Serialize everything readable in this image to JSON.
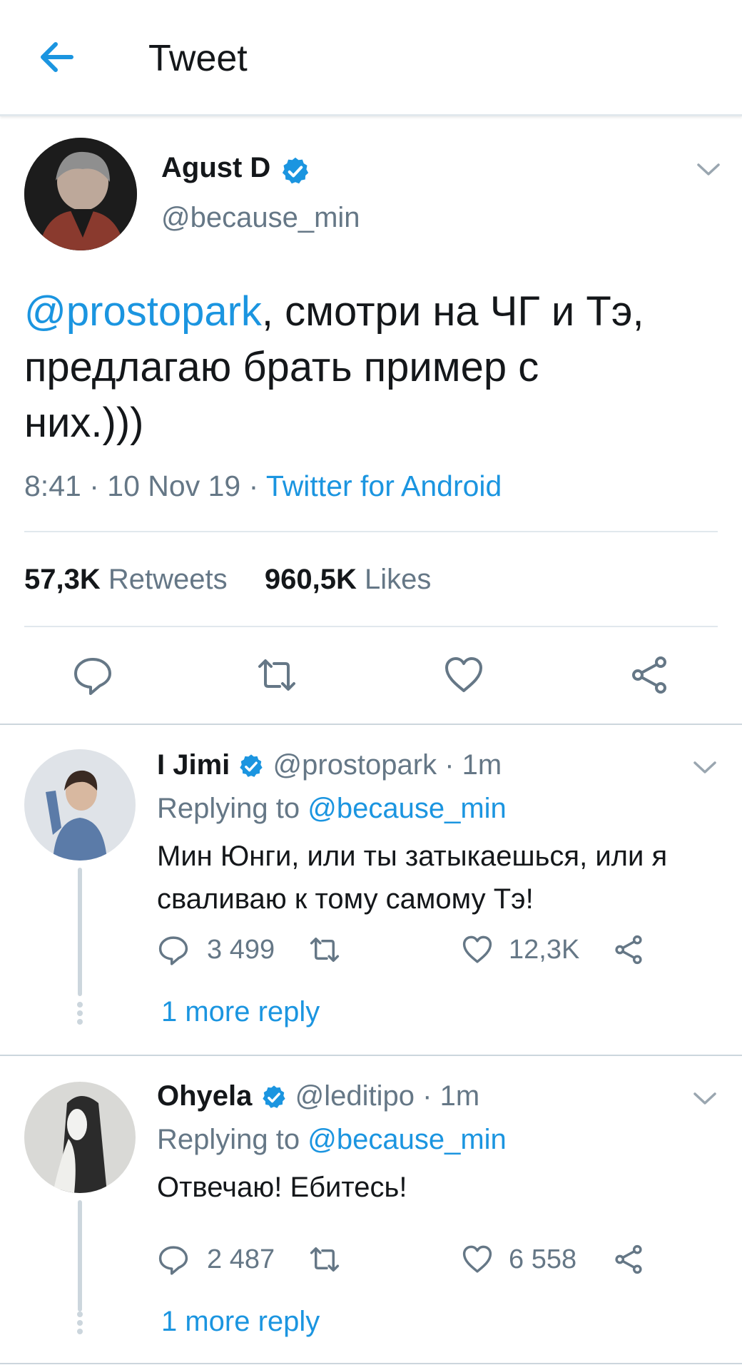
{
  "header": {
    "title": "Tweet"
  },
  "tweet": {
    "display_name": "Agust D",
    "handle": "@because_min",
    "mention": "@prostopark",
    "text_rest_1": ", смотри на ЧГ и Тэ,",
    "text_line_2": "предлагаю брать пример с",
    "text_line_3": "них.)))",
    "time": "8:41",
    "sep1": "·",
    "date": "10 Nov 19",
    "sep2": "·",
    "source": "Twitter for Android",
    "retweets_count": "57,3K",
    "retweets_label": "Retweets",
    "likes_count": "960,5K",
    "likes_label": "Likes"
  },
  "replies": [
    {
      "display_name": "I Jimi",
      "handle": "@prostopark",
      "age": "· 1m",
      "replying_prefix": "Replying to",
      "replying_to": "@because_min",
      "text_line_1": "Мин Юнги, или ты затыкаешься, или я",
      "text_line_2": "сваливаю к тому самому Тэ!",
      "reply_count": "3 499",
      "like_count": "12,3K",
      "more": "1 more reply"
    },
    {
      "display_name": "Ohyela",
      "handle": "@leditipo",
      "age": "· 1m",
      "replying_prefix": "Replying to",
      "replying_to": "@because_min",
      "text_line_1": "Отвечаю! Ебитесь!",
      "reply_count": "2 487",
      "like_count": "6 558",
      "more": "1 more reply"
    }
  ],
  "colors": {
    "accent": "#1b95e0",
    "secondary": "#657786",
    "divider": "#e1e8ed"
  }
}
